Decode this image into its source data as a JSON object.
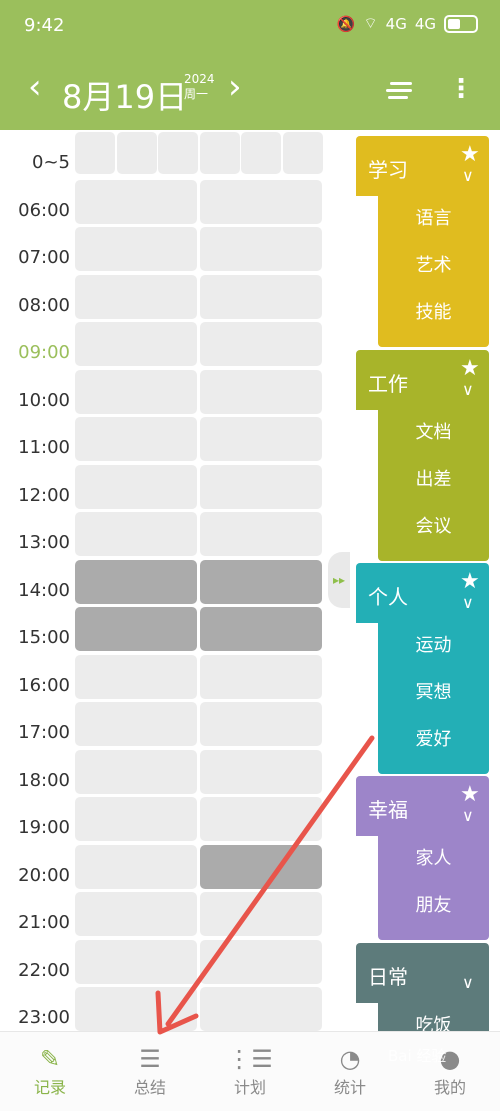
{
  "status_bar": {
    "time": "9:42",
    "signal_1": "4G",
    "signal_2": "4G"
  },
  "header": {
    "prev_icon": "chevron-left-icon",
    "date": "8月19日",
    "year": "2024",
    "weekday": "周一",
    "next_icon": "chevron-right-icon",
    "menu_icon": "list-icon",
    "more_icon": "more-vertical-icon"
  },
  "time_labels": [
    "0~5",
    "06:00",
    "07:00",
    "08:00",
    "09:00",
    "10:00",
    "11:00",
    "12:00",
    "13:00",
    "14:00",
    "15:00",
    "16:00",
    "17:00",
    "18:00",
    "19:00",
    "20:00",
    "21:00",
    "22:00",
    "23:00"
  ],
  "current_hour": "09:00",
  "colors": {
    "accent": "#9bbf5c",
    "current_hour": "#9bbf5c",
    "study": "#e0bc1f",
    "work": "#a8b42a",
    "personal": "#23afb6",
    "happiness": "#9d85c9",
    "daily": "#5d7b7b",
    "filled": "#ababab",
    "empty": "#ececec"
  },
  "categories": [
    {
      "title": "学习",
      "items": [
        "语言",
        "艺术",
        "技能"
      ],
      "starred": true
    },
    {
      "title": "工作",
      "items": [
        "文档",
        "出差",
        "会议"
      ],
      "starred": true
    },
    {
      "title": "个人",
      "items": [
        "运动",
        "冥想",
        "爱好"
      ],
      "starred": true
    },
    {
      "title": "幸福",
      "items": [
        "家人",
        "朋友"
      ],
      "starred": true
    },
    {
      "title": "日常",
      "items": [
        "吃饭"
      ],
      "starred": false
    }
  ],
  "bottom_tabs": [
    {
      "label": "记录",
      "icon": "pen-icon",
      "active": true
    },
    {
      "label": "总结",
      "icon": "summary-icon",
      "active": false
    },
    {
      "label": "计划",
      "icon": "plan-icon",
      "active": false
    },
    {
      "label": "统计",
      "icon": "pie-chart-icon",
      "active": false
    },
    {
      "label": "我的",
      "icon": "user-icon",
      "active": false
    }
  ],
  "watermark": "Bai 经验"
}
